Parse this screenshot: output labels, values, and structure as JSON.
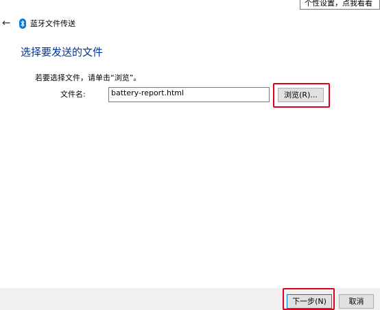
{
  "tooltip": {
    "text": "个性设置，点我看看"
  },
  "titlebar": {
    "back_icon": "back-arrow-icon",
    "app_icon": "bluetooth-icon",
    "title": "蓝牙文件传送"
  },
  "main": {
    "heading": "选择要发送的文件",
    "instruction": "若要选择文件，请单击“浏览”。",
    "file_label": "文件名:",
    "file_value": "battery-report.html",
    "browse_label": "浏览(R)..."
  },
  "footer": {
    "next_label": "下一步(N)",
    "cancel_label": "取消"
  },
  "colors": {
    "heading": "#003399",
    "highlight": "#e0001a",
    "bluetooth": "#0078d7"
  }
}
